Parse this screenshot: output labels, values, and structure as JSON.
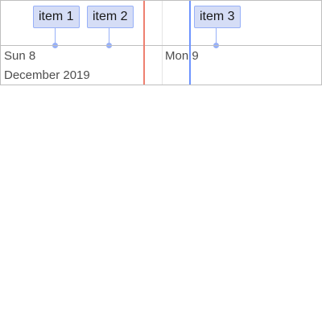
{
  "timeline": {
    "items": [
      {
        "label": "item 1"
      },
      {
        "label": "item 2"
      },
      {
        "label": "item 3"
      }
    ],
    "axis": {
      "minor_labels": [
        "Sun 8",
        "Mon 9"
      ],
      "major_label": "December 2019"
    },
    "colors": {
      "item_background": "#d5ddf6",
      "item_border": "#97b0f8",
      "current_time_line": "#ee8070",
      "custom_time_line": "#6e94ff",
      "grid": "#e5e5e5",
      "frame_border": "#bfbfbf"
    }
  }
}
